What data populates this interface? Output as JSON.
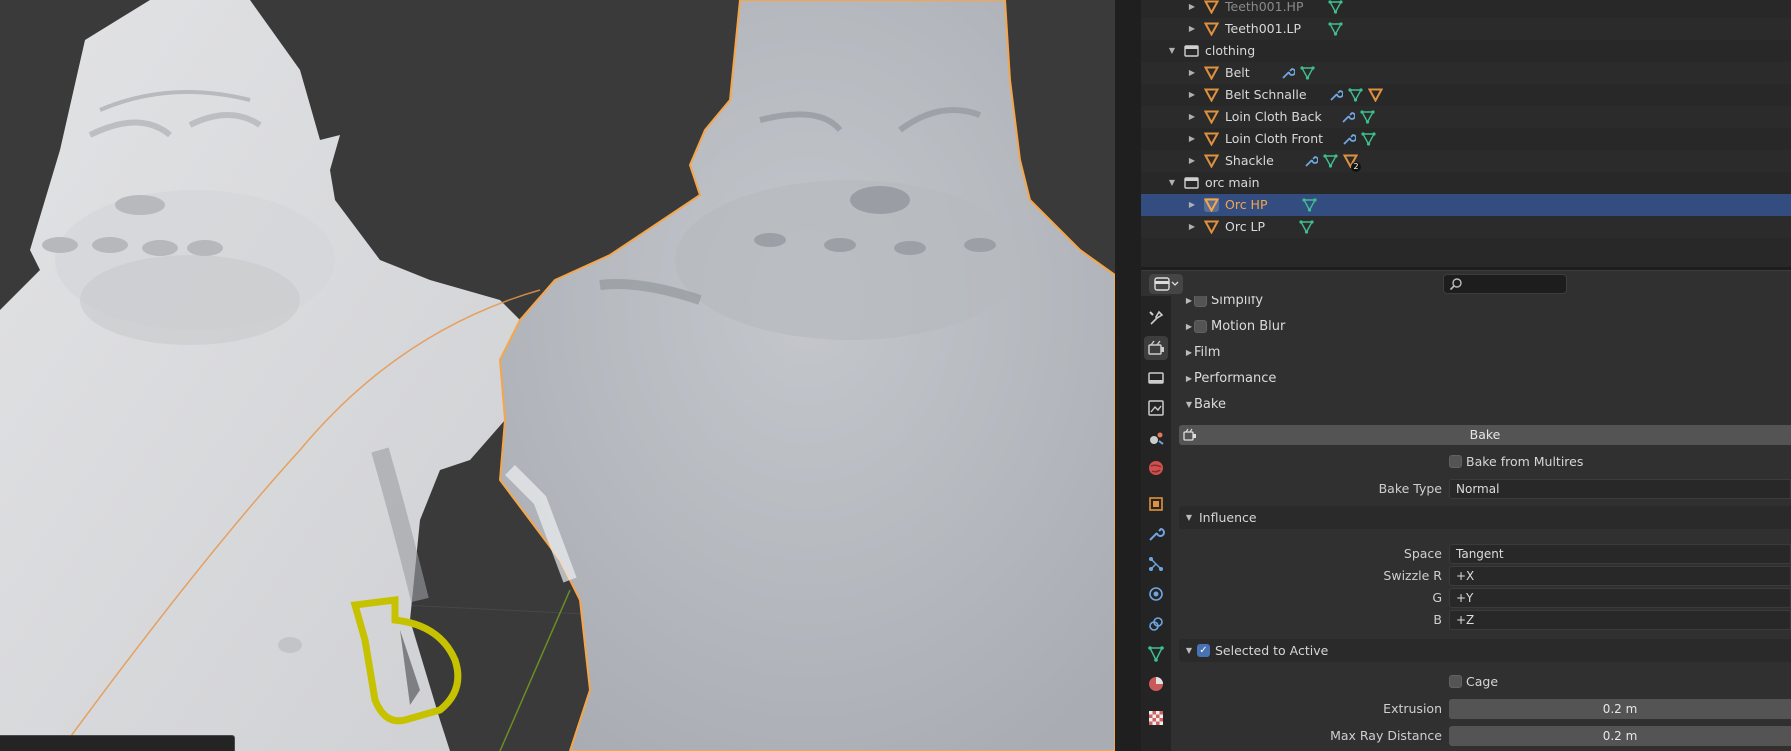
{
  "outliner": {
    "rows": [
      {
        "label": "Teeth001.HP",
        "type": "object"
      },
      {
        "label": "Teeth001.LP",
        "type": "object"
      },
      {
        "label": "clothing",
        "type": "collection"
      },
      {
        "label": "Belt",
        "type": "object"
      },
      {
        "label": "Belt Schnalle",
        "type": "object"
      },
      {
        "label": "Loin Cloth Back",
        "type": "object"
      },
      {
        "label": "Loin Cloth Front",
        "type": "object"
      },
      {
        "label": "Shackle",
        "type": "object",
        "badge": "2"
      },
      {
        "label": "orc main",
        "type": "collection"
      },
      {
        "label": "Orc HP",
        "type": "object",
        "selected": true
      },
      {
        "label": "Orc LP",
        "type": "object"
      }
    ]
  },
  "properties": {
    "panels": {
      "simplify": "Simplify",
      "motion_blur": "Motion Blur",
      "film": "Film",
      "performance": "Performance",
      "bake": "Bake"
    },
    "bake_button": "Bake",
    "bake_from_multires": {
      "label": "Bake from Multires",
      "checked": false
    },
    "bake_type": {
      "label": "Bake Type",
      "value": "Normal"
    },
    "influence": {
      "title": "Influence",
      "space": {
        "label": "Space",
        "value": "Tangent"
      },
      "swizzle_r": {
        "label": "Swizzle R",
        "value": "+X"
      },
      "g": {
        "label": "G",
        "value": "+Y"
      },
      "b": {
        "label": "B",
        "value": "+Z"
      }
    },
    "selected_to_active": {
      "title": "Selected to Active",
      "checked": true,
      "cage": {
        "label": "Cage",
        "checked": false
      },
      "extrusion": {
        "label": "Extrusion",
        "value": "0.2 m"
      },
      "max_ray_distance": {
        "label": "Max Ray Distance",
        "value": "0.2 m"
      }
    }
  },
  "tabs": [
    "tool",
    "render",
    "output",
    "view-layer",
    "scene",
    "world",
    "object",
    "modifiers",
    "particles",
    "physics",
    "constraints",
    "data",
    "material",
    "texture"
  ],
  "colors": {
    "accent_orange": "#f5a54a",
    "selection_blue": "#334d80",
    "mesh_green": "#3fbf8f",
    "wrench_blue": "#6fa6e0"
  }
}
